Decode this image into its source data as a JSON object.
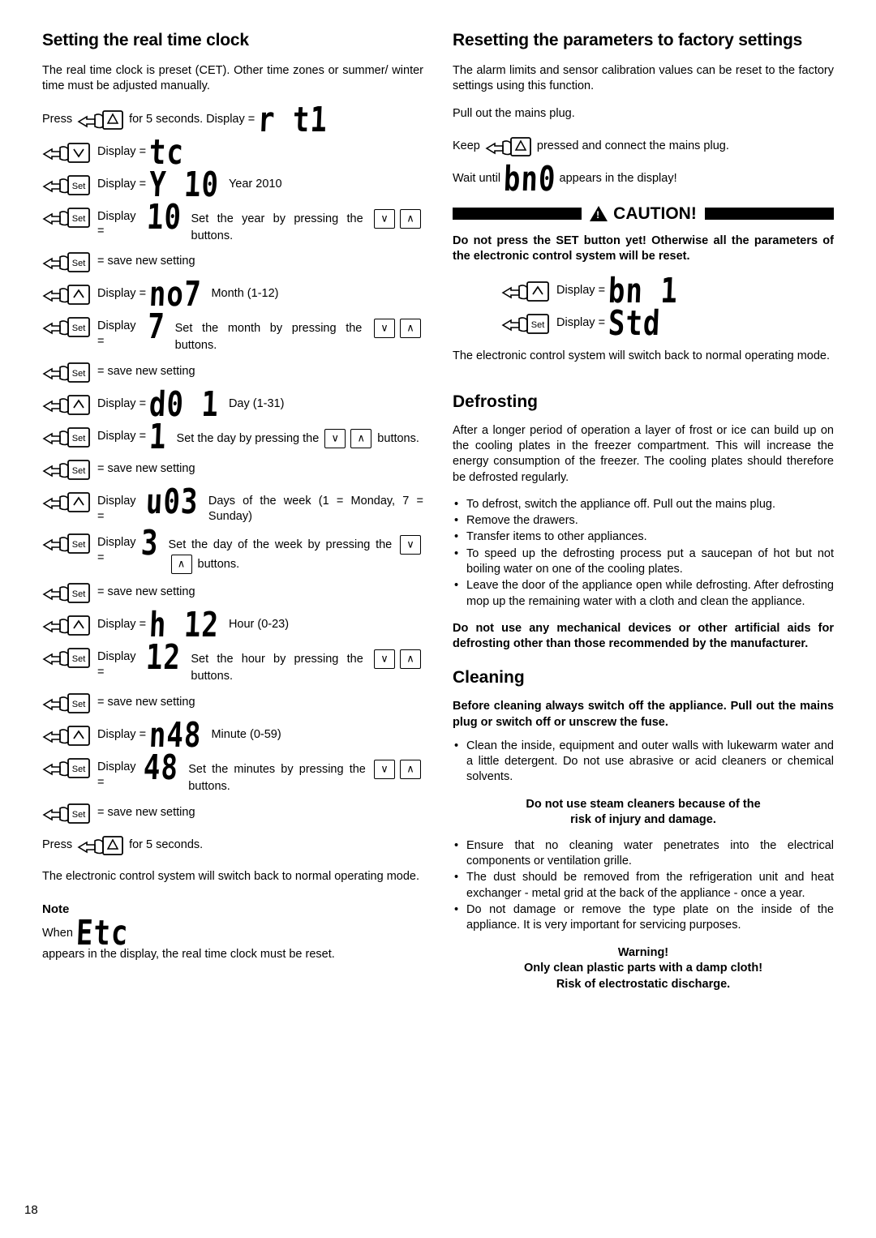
{
  "page_number": "18",
  "left_column": {
    "title": "Setting the real time clock",
    "intro": "The real time clock is preset (CET). Other time zones or summer/ winter time must be adjusted manually.",
    "press_intro": {
      "pre": "Press",
      "post": "for 5 seconds. Display =",
      "display": "r t1"
    },
    "steps": [
      {
        "key": "down",
        "label": "Display =",
        "display": "tc",
        "note": ""
      },
      {
        "key": "set",
        "label": "Display =",
        "display": "Y 10",
        "note": "Year 2010"
      },
      {
        "key": "set",
        "label": "Display =",
        "display": "10",
        "note": "Set the year by pressing the",
        "note_after": "buttons.",
        "arrows": true
      },
      {
        "key": "set",
        "label": "= save new setting",
        "display": "",
        "note": ""
      },
      {
        "key": "up",
        "label": "Display =",
        "display": "no7",
        "note": "Month (1-12)"
      },
      {
        "key": "set",
        "label": "Display =",
        "display": "7",
        "note": "Set the month by pressing the",
        "note_after": "buttons.",
        "arrows": true
      },
      {
        "key": "set",
        "label": "= save new setting",
        "display": "",
        "note": ""
      },
      {
        "key": "up",
        "label": "Display =",
        "display": "d0 1",
        "note": "Day (1-31)"
      },
      {
        "key": "set",
        "label": "Display =",
        "display": "1",
        "note": "Set the day by pressing the",
        "note_after": "buttons.",
        "arrows": true
      },
      {
        "key": "set",
        "label": "= save new setting",
        "display": "",
        "note": ""
      },
      {
        "key": "up",
        "label": "Display =",
        "display": "u03",
        "note": "Days of the week (1 = Monday, 7 = Sunday)"
      },
      {
        "key": "set",
        "label": "Display =",
        "display": "3",
        "note": "Set the day of the week by pressing the",
        "note_after": "buttons.",
        "arrows": true
      },
      {
        "key": "set",
        "label": "= save new setting",
        "display": "",
        "note": ""
      },
      {
        "key": "up",
        "label": "Display =",
        "display": "h 12",
        "note": "Hour (0-23)"
      },
      {
        "key": "set",
        "label": "Display =",
        "display": "12",
        "note": "Set the hour by pressing the",
        "note_after": "buttons.",
        "arrows": true
      },
      {
        "key": "set",
        "label": "= save new setting",
        "display": "",
        "note": ""
      },
      {
        "key": "up",
        "label": "Display =",
        "display": "n48",
        "note": "Minute (0-59)"
      },
      {
        "key": "set",
        "label": "Display =",
        "display": "48",
        "note": "Set the minutes by pressing the",
        "note_after": "buttons.",
        "arrows": true
      },
      {
        "key": "set",
        "label": "= save new setting",
        "display": "",
        "note": ""
      }
    ],
    "press_end": {
      "pre": "Press",
      "post": "for 5 seconds."
    },
    "closing": "The electronic control system will switch back to normal operating mode.",
    "note_heading": "Note",
    "note_text_pre": "When",
    "note_display": "Etc",
    "note_text_post": "appears in the display, the real time clock must be reset."
  },
  "right_column": {
    "title": "Resetting the parameters to factory settings",
    "intro": "The alarm limits and sensor calibration values can be reset to the factory settings using this function.",
    "pull_plug": "Pull out the mains plug.",
    "keep_pre": "Keep",
    "keep_post": "pressed and connect the mains plug.",
    "wait_pre": "Wait until",
    "wait_display": "bn0",
    "wait_post": "appears in the display!",
    "caution_label": "CAUTION!",
    "caution_text": "Do not press the SET button yet! Otherwise all the parameters of the electronic control system will be reset.",
    "steps": [
      {
        "key": "up",
        "label": "Display =",
        "display": "bn 1"
      },
      {
        "key": "set",
        "label": "Display =",
        "display": "Std"
      }
    ],
    "closing": "The electronic control system will switch back to normal operating mode.",
    "defrosting": {
      "title": "Defrosting",
      "paragraph": "After a longer period of operation a layer of frost or ice can build up on the cooling plates in the freezer compartment. This will increase the energy consumption of the freezer. The cooling plates should therefore be defrosted regularly.",
      "bullets": [
        "To defrost, switch the appliance off. Pull out the mains plug.",
        "Remove the drawers.",
        "Transfer items to other appliances.",
        "To speed up the defrosting process put a saucepan of hot but not boiling water on one of the cooling plates.",
        "Leave the door of the appliance open while defrosting. After defrosting mop up the remaining water with a cloth and clean the appliance."
      ],
      "bold_note": "Do not use any mechanical devices or other artificial aids for defrosting other than those recommended by the manufacturer."
    },
    "cleaning": {
      "title": "Cleaning",
      "bold_intro": "Before cleaning always switch off the appliance. Pull out the mains plug or switch off or unscrew the fuse.",
      "bullets_1": [
        "Clean the inside, equipment and outer walls with lukewarm water and a little detergent. Do not use abrasive or acid cleaners or chemical solvents."
      ],
      "center_note_1": "Do not use steam cleaners because of the",
      "center_note_2": "risk of injury and damage.",
      "bullets_2": [
        "Ensure that no cleaning water penetrates into the electrical components or ventilation grille.",
        "The dust should be removed from the refrigeration unit and heat exchanger - metal grid at the back of the appliance - once a year.",
        "Do not damage or remove the type plate on the inside of the appliance. It is very important for servicing purposes."
      ],
      "warning_heading": "Warning!",
      "warning_line_1": "Only clean plastic parts with a damp cloth!",
      "warning_line_2": "Risk of electrostatic discharge."
    }
  },
  "icons": {
    "hand_press": "hand-pressing-icon",
    "key_set": "Set",
    "key_up": "∧",
    "key_down": "∨",
    "key_alarm": "⚠"
  }
}
